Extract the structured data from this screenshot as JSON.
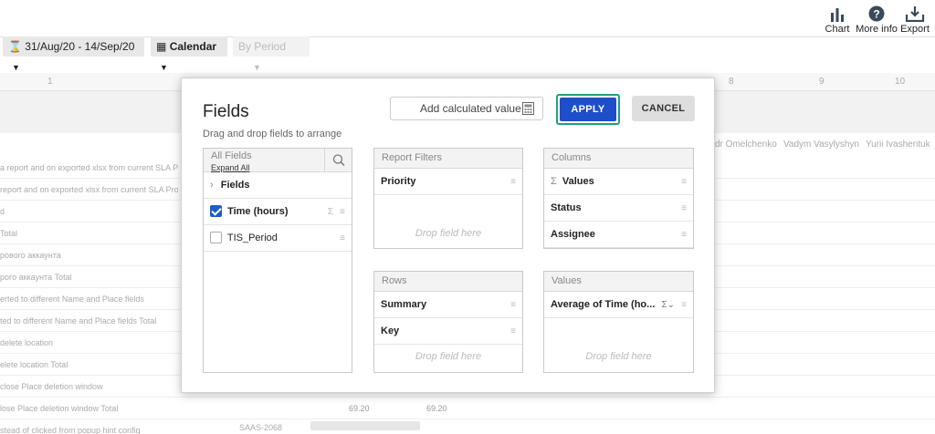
{
  "topbar": {
    "chart_label": "Chart",
    "more_info_label": "More info",
    "export_label": "Export"
  },
  "toolbar": {
    "date_range": "31/Aug/20 - 14/Sep/20",
    "calendar_label": "Calendar",
    "period_label": "By Period"
  },
  "background": {
    "column_numbers": [
      "1",
      "8",
      "9",
      "10"
    ],
    "header_names": [
      "dr Omelchenko",
      "Vadym Vasylyshyn",
      "Yurii Ivashentuk"
    ],
    "rows": [
      "a report and on exported xlsx from current SLA Pro",
      "report and on exported xlsx from current SLA Prod",
      "d",
      "Total",
      "рового аккаунта",
      "рого аккаунта Total",
      "erted to different Name and Place fields",
      "ted to different Name and Place fields Total",
      "delete location",
      "elete location Total",
      "close Place deletion window",
      "lose Place deletion window Total",
      "stead of clicked from popup hint config"
    ],
    "total_values": [
      "69.20",
      "69.20"
    ],
    "code_cell": "SAAS-2068"
  },
  "modal": {
    "title": "Fields",
    "subtitle": "Drag and drop fields to arrange",
    "add_calculated_label": "Add calculated value",
    "apply_label": "APPLY",
    "cancel_label": "CANCEL",
    "all_fields": {
      "title": "All Fields",
      "expand_all": "Expand All",
      "group_label": "Fields",
      "items": [
        {
          "label": "Time (hours)",
          "checked": true,
          "is_measure": true
        },
        {
          "label": "TIS_Period",
          "checked": false,
          "is_measure": false
        }
      ]
    },
    "report_filters": {
      "title": "Report Filters",
      "items": [
        "Priority"
      ],
      "drop_hint": "Drop field here"
    },
    "columns": {
      "title": "Columns",
      "items": [
        "Values",
        "Status",
        "Assignee"
      ]
    },
    "rows": {
      "title": "Rows",
      "items": [
        "Summary",
        "Key"
      ],
      "drop_hint": "Drop field here"
    },
    "values": {
      "title": "Values",
      "items": [
        "Average of Time (ho..."
      ],
      "drop_hint": "Drop field here"
    }
  },
  "colors": {
    "apply_bg": "#1e4fc8",
    "apply_focus_ring": "#20a080",
    "checkbox_on": "#1e5ec8"
  }
}
